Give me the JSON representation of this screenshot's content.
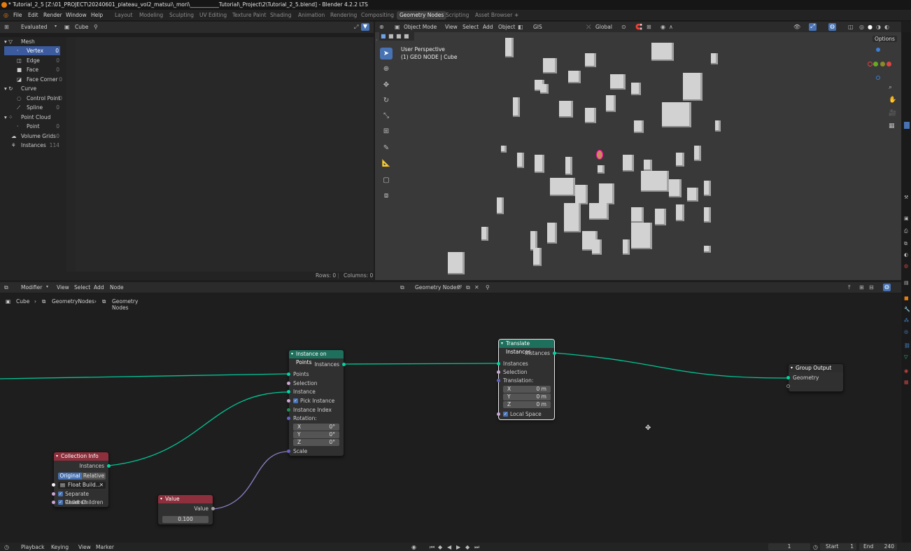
{
  "title_bar": {
    "text": "* Tutorial_2_5 [Z:\\01_PROJECT\\20240601_plateau_vol2_matsui\\_mori\\___________Tutorial\\_Project\\2\\Tutorial_2_5.blend] - Blender 4.2.2 LTS"
  },
  "menu": {
    "items": [
      "File",
      "Edit",
      "Render",
      "Window",
      "Help"
    ]
  },
  "workspaces": [
    "Layout",
    "Modeling",
    "Sculpting",
    "UV Editing",
    "Texture Paint",
    "Shading",
    "Animation",
    "Rendering",
    "Compositing",
    "Geometry Nodes",
    "Scripting",
    "Asset Browser"
  ],
  "active_workspace": "Geometry Nodes",
  "spreadsheet": {
    "mode": "Evaluated",
    "object": "Cube",
    "tree": [
      {
        "label": "Mesh",
        "count": "",
        "indent": 0
      },
      {
        "label": "Vertex",
        "count": "0",
        "indent": 2
      },
      {
        "label": "Edge",
        "count": "0",
        "indent": 2
      },
      {
        "label": "Face",
        "count": "0",
        "indent": 2
      },
      {
        "label": "Face Corner",
        "count": "0",
        "indent": 2
      },
      {
        "label": "Curve",
        "count": "",
        "indent": 0
      },
      {
        "label": "Control Point",
        "count": "0",
        "indent": 2
      },
      {
        "label": "Spline",
        "count": "0",
        "indent": 2
      },
      {
        "label": "Point Cloud",
        "count": "",
        "indent": 0
      },
      {
        "label": "Point",
        "count": "0",
        "indent": 2
      },
      {
        "label": "Volume Grids",
        "count": "0",
        "indent": 1
      },
      {
        "label": "Instances",
        "count": "114",
        "indent": 1
      }
    ],
    "selected_index": 1,
    "rows": "Rows: 0",
    "columns": "Columns: 0"
  },
  "viewport": {
    "mode": "Object Mode",
    "menus": [
      "View",
      "Select",
      "Add",
      "Object"
    ],
    "gis": "GIS",
    "orientation": "Global",
    "options": "Options",
    "overlay_line1": "User Perspective",
    "overlay_line2": "(1) GEO NODE | Cube"
  },
  "node_header": {
    "mode": "Modifier",
    "menus": [
      "View",
      "Select",
      "Add",
      "Node"
    ],
    "tree_name": "Geometry Nodes"
  },
  "breadcrumb": [
    "Cube",
    "GeometryNodes",
    "Geometry Nodes"
  ],
  "nodes": {
    "instance_on_points": {
      "title": "Instance on Points",
      "out": "Instances",
      "inputs": [
        "Points",
        "Selection",
        "Instance",
        "Pick Instance",
        "Instance Index",
        "Rotation:",
        "Scale"
      ],
      "rotation": [
        {
          "k": "X",
          "v": "0°"
        },
        {
          "k": "Y",
          "v": "0°"
        },
        {
          "k": "Z",
          "v": "0°"
        }
      ],
      "header_color": "#1e6f5c"
    },
    "translate_instances": {
      "title": "Translate Instances",
      "out": "Instances",
      "inputs": [
        "Instances",
        "Selection",
        "Translation:"
      ],
      "translation": [
        {
          "k": "X",
          "v": "0 m"
        },
        {
          "k": "Y",
          "v": "0 m"
        },
        {
          "k": "Z",
          "v": "0 m"
        }
      ],
      "local_space": "Local Space",
      "header_color": "#1e6f5c"
    },
    "group_output": {
      "title": "Group Output",
      "in": "Geometry"
    },
    "collection_info": {
      "title": "Collection Info",
      "out": "Instances",
      "toggle": [
        "Original",
        "Relative"
      ],
      "collection": "Float Build...",
      "separate_children": "Separate Children",
      "reset_children": "Reset Children",
      "header_color": "#8d2f3c"
    },
    "value": {
      "title": "Value",
      "out": "Value",
      "value": "0.100",
      "header_color": "#8d2f3c"
    }
  },
  "timeline": {
    "menus": [
      "Playback",
      "Keying",
      "View",
      "Marker"
    ],
    "current_frame": "1",
    "start_label": "Start",
    "start": "1",
    "end_label": "End",
    "end": "240"
  }
}
